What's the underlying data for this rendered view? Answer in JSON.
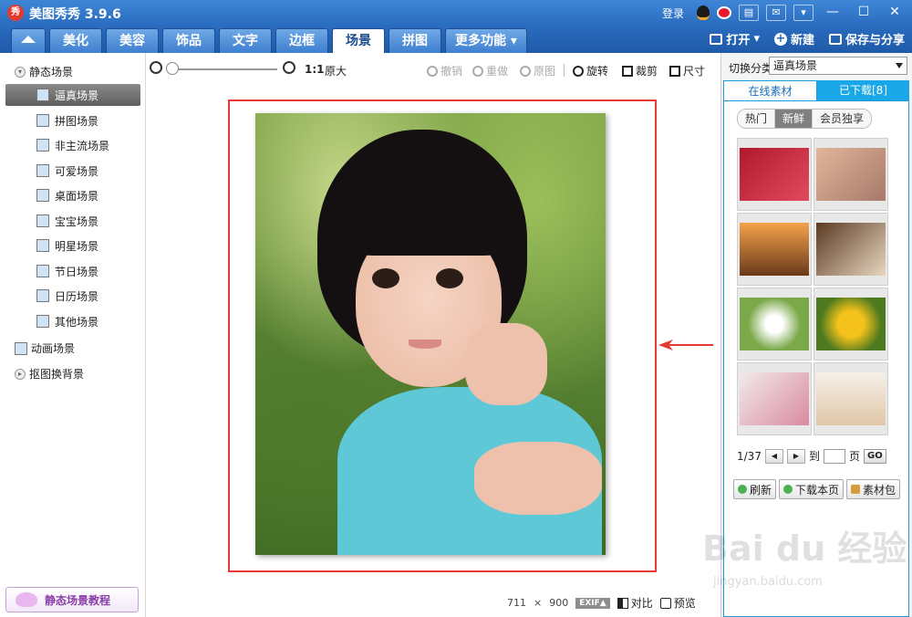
{
  "app": {
    "title": "美图秀秀 3.9.6",
    "logo_text": "秀"
  },
  "titlebar": {
    "login": "登录",
    "minimize": "—",
    "maximize": "☐",
    "close": "✕"
  },
  "tabs": {
    "items": [
      {
        "label": "美化"
      },
      {
        "label": "美容"
      },
      {
        "label": "饰品"
      },
      {
        "label": "文字"
      },
      {
        "label": "边框"
      },
      {
        "label": "场景"
      },
      {
        "label": "拼图"
      },
      {
        "label": "更多功能 ▾"
      }
    ],
    "active_index": 5
  },
  "actions": {
    "open": "打开",
    "open_caret": "▾",
    "new": "新建",
    "save_share": "保存与分享"
  },
  "left": {
    "group_static": "静态场景",
    "items": [
      {
        "label": "逼真场景"
      },
      {
        "label": "拼图场景"
      },
      {
        "label": "非主流场景"
      },
      {
        "label": "可爱场景"
      },
      {
        "label": "桌面场景"
      },
      {
        "label": "宝宝场景"
      },
      {
        "label": "明星场景"
      },
      {
        "label": "节日场景"
      },
      {
        "label": "日历场景"
      },
      {
        "label": "其他场景"
      }
    ],
    "group_animated": "动画场景",
    "group_cutout": "抠图换背景",
    "tutorial": "静态场景教程"
  },
  "toolbar": {
    "ratio": "1:1",
    "original_size": "原大",
    "undo": "撤销",
    "redo": "重做",
    "original": "原图",
    "rotate": "旋转",
    "crop": "裁剪",
    "size": "尺寸",
    "zoom_level": 0
  },
  "status": {
    "width": "711",
    "times": "×",
    "height": "900",
    "exif": "EXIF▲",
    "compare": "对比",
    "preview": "预览"
  },
  "right": {
    "switch_label": "切换分类",
    "switch_value": "逼真场景",
    "tab_online": "在线素材",
    "tab_downloaded": "已下载[8]",
    "filters": [
      {
        "label": "热门"
      },
      {
        "label": "新鲜"
      },
      {
        "label": "会员独享"
      }
    ],
    "pager": {
      "current": "1/37",
      "goto": "到",
      "page": "页",
      "go": "GO"
    },
    "buttons": {
      "refresh": "刷新",
      "download_page": "下载本页",
      "pack": "素材包"
    }
  },
  "watermark": {
    "main": "Bai du 经验",
    "sub": "jingyan.baidu.com"
  },
  "colors": {
    "accent": "#2a6cc0",
    "highlight_frame": "#e53935",
    "online_tab": "#1aa7e8"
  }
}
